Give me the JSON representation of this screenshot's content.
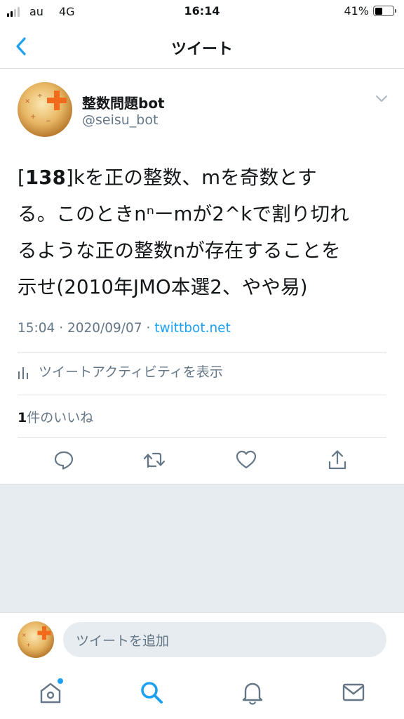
{
  "status_bar": {
    "carrier": "au",
    "network": "4G",
    "time": "16:14",
    "battery": "41%",
    "battery_level": 0.41
  },
  "nav": {
    "title": "ツイート",
    "back_icon": "chevron-left-icon"
  },
  "tweet": {
    "author_name": "整数問題bot",
    "author_handle": "@seisu_bot",
    "text_number": "138",
    "text_bracket_open": "[",
    "text_line1_rest": "]kを正の整数、mを奇数とす",
    "text_line2": "る。このときnⁿーmが2^kで割り切れ",
    "text_line3": "るような正の整数nが存在することを",
    "text_line4": "示せ(2010年JMO本選2、やや易)",
    "meta_time": "15:04 · 2020/09/07 · ",
    "meta_source": "twittbot.net",
    "activity_label": "ツイートアクティビティを表示",
    "likes_count": "1",
    "likes_label": "件のいいね"
  },
  "actions": [
    "reply-icon",
    "retweet-icon",
    "like-icon",
    "share-icon"
  ],
  "compose": {
    "placeholder": "ツイートを追加"
  },
  "tabbar": [
    "home-icon",
    "search-icon",
    "notifications-icon",
    "messages-icon"
  ],
  "colors": {
    "accent": "#1da1f2",
    "secondary_text": "#657786",
    "divider": "#dfe3e6",
    "background_grey": "#e6ecf0"
  }
}
